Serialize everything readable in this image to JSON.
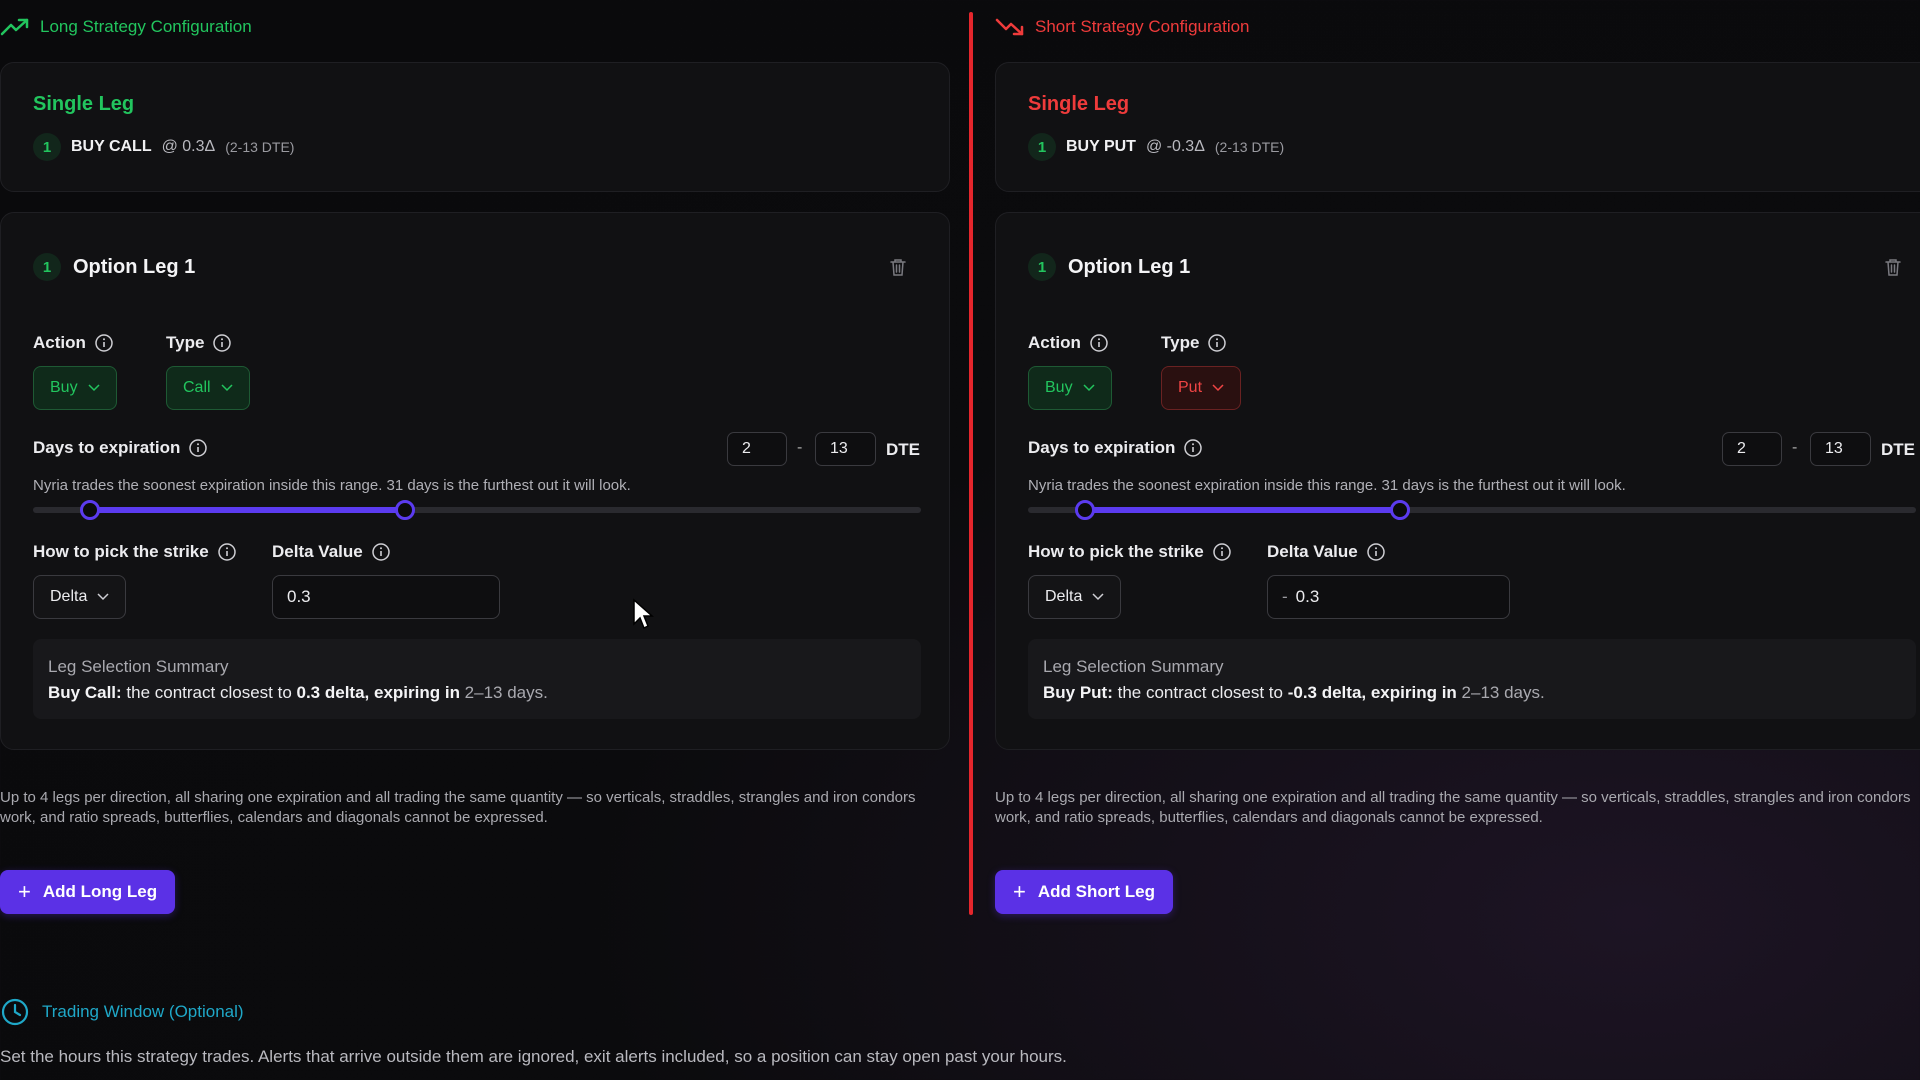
{
  "long": {
    "section_title": "Long Strategy Configuration",
    "strategy_name": "Single Leg",
    "summary_leg": {
      "number": "1",
      "action": "BUY CALL",
      "delta": "@ 0.3Δ",
      "dte": "(2-13 DTE)"
    },
    "leg": {
      "number": "1",
      "title": "Option Leg 1",
      "action_label": "Action",
      "action_value": "Buy",
      "type_label": "Type",
      "type_value": "Call",
      "days_label": "Days to expiration",
      "dte_min": "2",
      "dte_dash": "-",
      "dte_max": "13",
      "dte_unit": "DTE",
      "help": "Nyria trades the soonest expiration inside this range. 31 days is the furthest out it will look.",
      "slider": {
        "min": 0,
        "max": 31,
        "low": 2,
        "high": 13
      },
      "strike_label": "How to pick the strike",
      "strike_value": "Delta",
      "delta_label": "Delta Value",
      "delta_value": "0.3",
      "summary_title": "Leg Selection Summary",
      "summary_action": "Buy Call:",
      "summary_mid": " the contract closest to ",
      "summary_delta": "0.3 delta",
      "summary_exp": ", expiring in ",
      "summary_days": "2–13 days."
    },
    "footnote": "Up to 4 legs per direction, all sharing one expiration and all trading the same quantity — so verticals, straddles, strangles and iron condors work, and ratio spreads, butterflies, calendars and diagonals cannot be expressed.",
    "add_button": "Add Long Leg"
  },
  "short": {
    "section_title": "Short Strategy Configuration",
    "strategy_name": "Single Leg",
    "summary_leg": {
      "number": "1",
      "action": "BUY PUT",
      "delta": "@ -0.3Δ",
      "dte": "(2-13 DTE)"
    },
    "leg": {
      "number": "1",
      "title": "Option Leg 1",
      "action_label": "Action",
      "action_value": "Buy",
      "type_label": "Type",
      "type_value": "Put",
      "days_label": "Days to expiration",
      "dte_min": "2",
      "dte_dash": "-",
      "dte_max": "13",
      "dte_unit": "DTE",
      "help": "Nyria trades the soonest expiration inside this range. 31 days is the furthest out it will look.",
      "slider": {
        "min": 0,
        "max": 31,
        "low": 2,
        "high": 13
      },
      "strike_label": "How to pick the strike",
      "strike_value": "Delta",
      "delta_label": "Delta Value",
      "delta_sign": "-",
      "delta_value": "0.3",
      "summary_title": "Leg Selection Summary",
      "summary_action": "Buy Put:",
      "summary_mid": " the contract closest to ",
      "summary_delta": "-0.3 delta",
      "summary_exp": ", expiring in ",
      "summary_days": "2–13 days."
    },
    "footnote": "Up to 4 legs per direction, all sharing one expiration and all trading the same quantity — so verticals, straddles, strangles and iron condors work, and ratio spreads, butterflies, calendars and diagonals cannot be expressed.",
    "add_button": "Add Short Leg"
  },
  "trading_window": {
    "title": "Trading Window (Optional)",
    "description": "Set the hours this strategy trades. Alerts that arrive outside them are ignored, exit alerts included, so a position can stay open past your hours."
  },
  "colors": {
    "long_accent": "#22c55e",
    "short_accent": "#ef3b3b",
    "primary_button": "#5b31e6",
    "slider": "#5b3bf0",
    "trading_window": "#1fa8c8"
  },
  "icons": [
    "trend-up-icon",
    "trend-down-icon",
    "trash-icon",
    "info-icon",
    "chevron-down-icon",
    "plus-icon",
    "clock-icon"
  ]
}
